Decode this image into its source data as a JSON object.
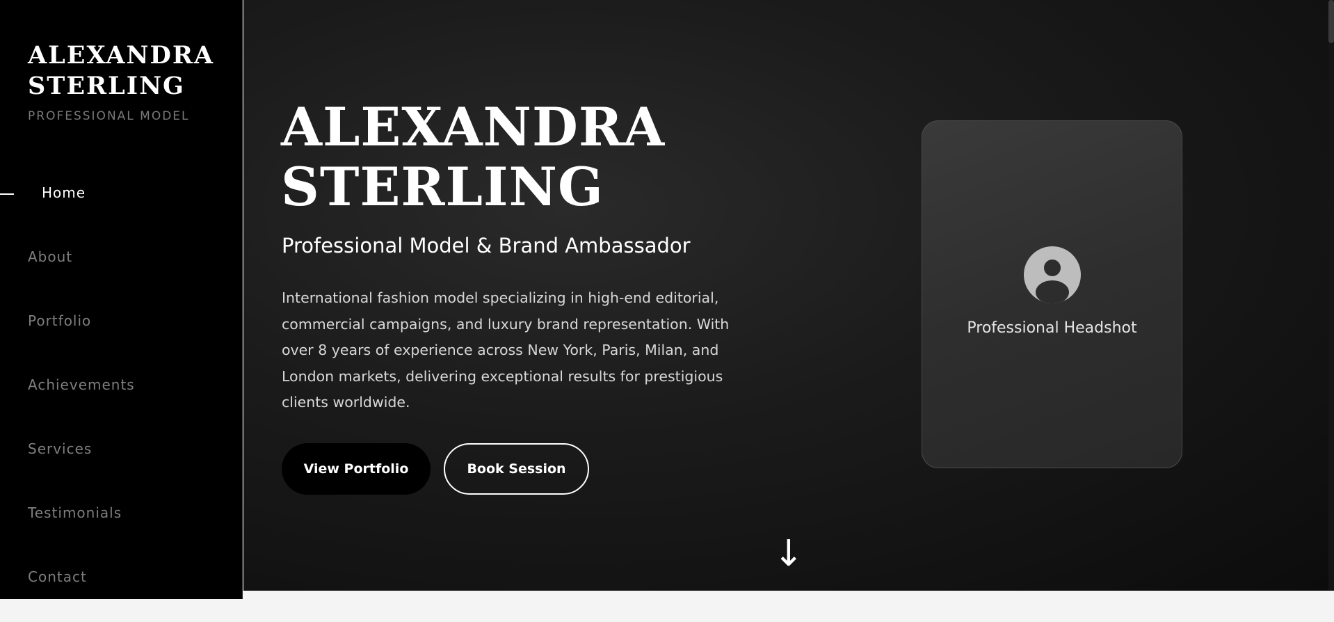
{
  "sidebar": {
    "brand_name": "ALEXANDRA STERLING",
    "brand_tagline": "PROFESSIONAL MODEL",
    "items": [
      {
        "label": "Home",
        "active": true
      },
      {
        "label": "About"
      },
      {
        "label": "Portfolio"
      },
      {
        "label": "Achievements"
      },
      {
        "label": "Services"
      },
      {
        "label": "Testimonials"
      },
      {
        "label": "Contact"
      }
    ]
  },
  "hero": {
    "title": "ALEXANDRA STERLING",
    "subtitle": "Professional Model & Brand Ambassador",
    "description": "International fashion model specializing in high-end editorial, commercial campaigns, and luxury brand representation. With over 8 years of experience across New York, Paris, Milan, and London markets, delivering exceptional results for prestigious clients worldwide.",
    "primary_button": "View Portfolio",
    "secondary_button": "Book Session",
    "scroll_icon": "arrow-down-icon"
  },
  "headshot": {
    "label": "Professional Headshot",
    "icon": "user-icon"
  },
  "colors": {
    "sidebar_bg": "#000000",
    "accent": "#ffffff",
    "muted_text": "#7e7e7e"
  }
}
